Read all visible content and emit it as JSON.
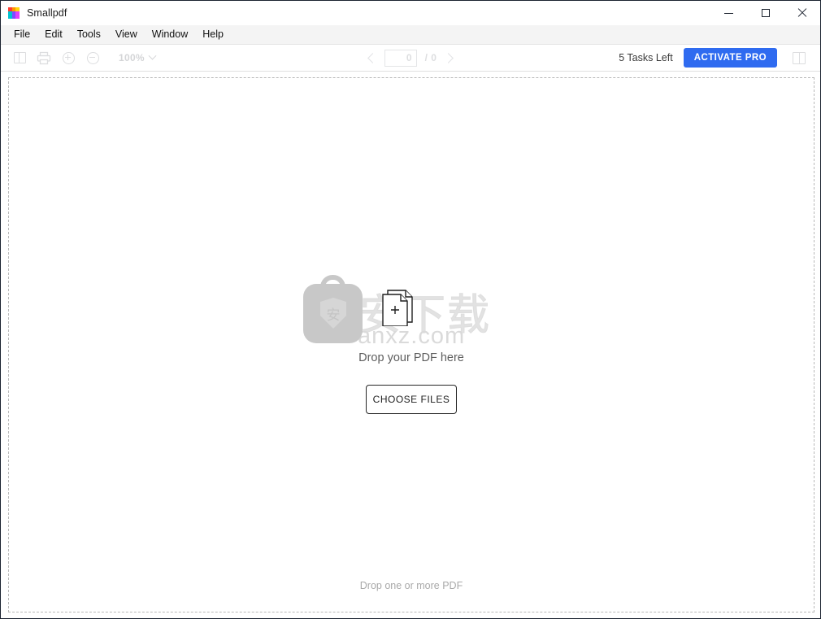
{
  "window": {
    "title": "Smallpdf",
    "icon_name": "smallpdf-logo-icon",
    "icon_colors": [
      "#ff3b30",
      "#ff9500",
      "#ffd60a",
      "#00c2d1",
      "#7b4dff",
      "#e040fb",
      "#00c2d1",
      "#7b4dff",
      "#e040fb"
    ],
    "controls": {
      "minimize": "minimize",
      "maximize": "maximize",
      "close": "close"
    }
  },
  "menubar": {
    "items": [
      {
        "label": "File"
      },
      {
        "label": "Edit"
      },
      {
        "label": "Tools"
      },
      {
        "label": "View"
      },
      {
        "label": "Window"
      },
      {
        "label": "Help"
      }
    ]
  },
  "toolbar": {
    "sidebar_toggle_icon": "panel-left-icon",
    "print_icon": "printer-icon",
    "zoom_in_icon": "zoom-in-icon",
    "zoom_out_icon": "zoom-out-icon",
    "zoom_level": "100%",
    "zoom_dropdown_icon": "chevron-down-icon",
    "prev_page_icon": "chevron-left-icon",
    "next_page_icon": "chevron-right-icon",
    "current_page": "0",
    "page_separator": "/ 0",
    "total_pages": "0",
    "tasks_left": "5 Tasks Left",
    "activate_label": "ACTIVATE PRO",
    "activate_color": "#2f6bf0",
    "right_panel_icon": "panel-right-icon"
  },
  "dropzone": {
    "doc_icon_name": "add-pdf-document-icon",
    "title": "Drop your PDF here",
    "choose_files_label": "CHOOSE FILES",
    "footer_hint": "Drop one or more PDF",
    "watermark": {
      "bag_icon": "anxz-bag-logo-icon",
      "shield_char": "安",
      "chinese_text": "安下载",
      "domain_text": "anxz.com"
    }
  }
}
